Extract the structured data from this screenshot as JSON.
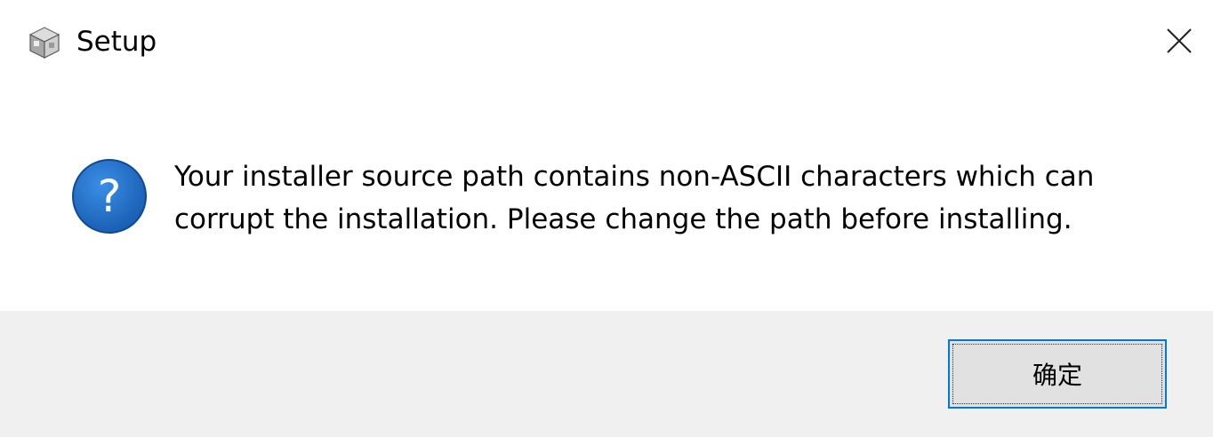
{
  "window": {
    "title": "Setup",
    "app_icon": "installer-box-icon",
    "close_icon": "close-icon"
  },
  "message": {
    "icon": "question-icon",
    "line1": "Your installer source path contains non-ASCII characters which can",
    "line2": "corrupt the installation. Please change the path before installing."
  },
  "buttons": {
    "ok_label": "确定"
  },
  "colors": {
    "question_icon": "#1a5fb4",
    "button_focus_border": "#0078d7",
    "footer_background": "#f0f0f0",
    "button_background": "#e1e1e1"
  }
}
